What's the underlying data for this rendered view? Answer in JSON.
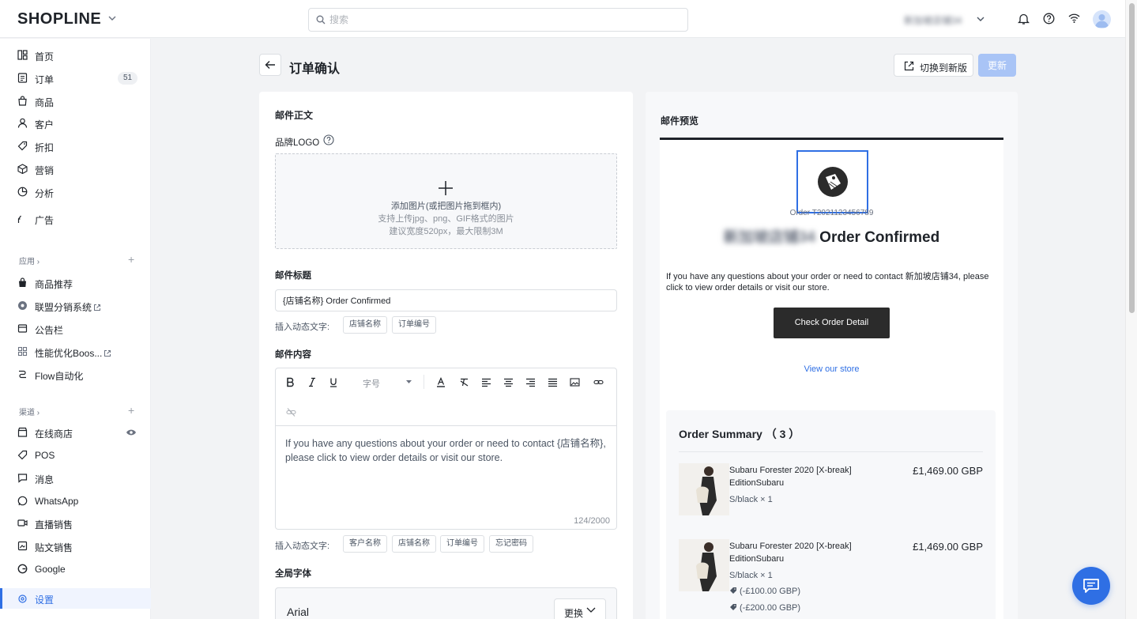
{
  "topbar": {
    "logo": "SHOPLINE",
    "search_placeholder": "搜索",
    "store_name": "新加坡店铺34"
  },
  "sidebar": {
    "items": [
      {
        "label": "首页",
        "icon": "home-icon"
      },
      {
        "label": "订单",
        "icon": "orders-icon",
        "badge": "51"
      },
      {
        "label": "商品",
        "icon": "bag-icon"
      },
      {
        "label": "客户",
        "icon": "user-icon"
      },
      {
        "label": "折扣",
        "icon": "tag-icon"
      },
      {
        "label": "营销",
        "icon": "cube-icon"
      },
      {
        "label": "分析",
        "icon": "pie-icon"
      },
      {
        "label": "广告",
        "icon": "ad-icon"
      }
    ],
    "apps_title": "应用",
    "apps": [
      {
        "label": "商品推荐",
        "icon": "recommend-icon"
      },
      {
        "label": "联盟分销系统",
        "icon": "affiliate-icon"
      },
      {
        "label": "公告栏",
        "icon": "announcement-icon"
      },
      {
        "label": "性能优化Boos...",
        "icon": "performance-icon"
      },
      {
        "label": "Flow自动化",
        "icon": "flow-icon"
      }
    ],
    "channels_title": "渠道",
    "channels": [
      {
        "label": "在线商店",
        "icon": "store-icon"
      },
      {
        "label": "POS",
        "icon": "pos-icon"
      },
      {
        "label": "消息",
        "icon": "message-icon"
      },
      {
        "label": "WhatsApp",
        "icon": "whatsapp-icon"
      },
      {
        "label": "直播销售",
        "icon": "live-icon"
      },
      {
        "label": "贴文销售",
        "icon": "post-icon"
      },
      {
        "label": "Google",
        "icon": "google-icon"
      }
    ],
    "settings_label": "设置"
  },
  "page": {
    "title": "订单确认",
    "switch_label": "切换到新版",
    "update_label": "更新"
  },
  "editor": {
    "section_title": "邮件正文",
    "logo_label": "品牌LOGO",
    "upload_line1": "添加图片(或把图片拖到框内)",
    "upload_line2": "支持上传jpg、png、GIF格式的图片",
    "upload_line3": "建议宽度520px，最大限制3M",
    "subject_label": "邮件标题",
    "subject_value": "{店铺名称} Order Confirmed",
    "insert_label": "插入动态文字:",
    "subject_chips": [
      "店铺名称",
      "订单编号"
    ],
    "content_label": "邮件内容",
    "font_size_placeholder": "字号",
    "content_text": "If you have any questions about your order or need to contact {店铺名称}, please click to view order details or visit our store.",
    "char_count": "124/2000",
    "content_chips": [
      "客户名称",
      "店铺名称",
      "订单编号",
      "忘记密码"
    ],
    "font_label": "全局字体",
    "font_value": "Arial",
    "change_label": "更换"
  },
  "preview": {
    "title": "邮件预览",
    "order_number": "Order T2021123456789",
    "store_name": "新加坡店铺34",
    "confirmed": " Order Confirmed",
    "body_text": "If you have any questions about your order or need to contact 新加坡店铺34, please click to view order details or visit our store.",
    "check_button": "Check Order Detail",
    "view_store": "View our store",
    "summary_title": "Order Summary （ 3 ）",
    "products": [
      {
        "name": "Subaru Forester 2020 [X-break] EditionSubaru",
        "variant": "S/black × 1",
        "price": "£1,469.00 GBP",
        "discounts": []
      },
      {
        "name": "Subaru Forester 2020 [X-break] EditionSubaru",
        "variant": "S/black × 1",
        "price": "£1,469.00 GBP",
        "discounts": [
          "(-£100.00 GBP)",
          "(-£200.00 GBP)"
        ]
      }
    ]
  },
  "colors": {
    "accent": "#2f6fe4",
    "update_disabled": "#a9c4f6",
    "dark_button": "#2b2b2b"
  }
}
